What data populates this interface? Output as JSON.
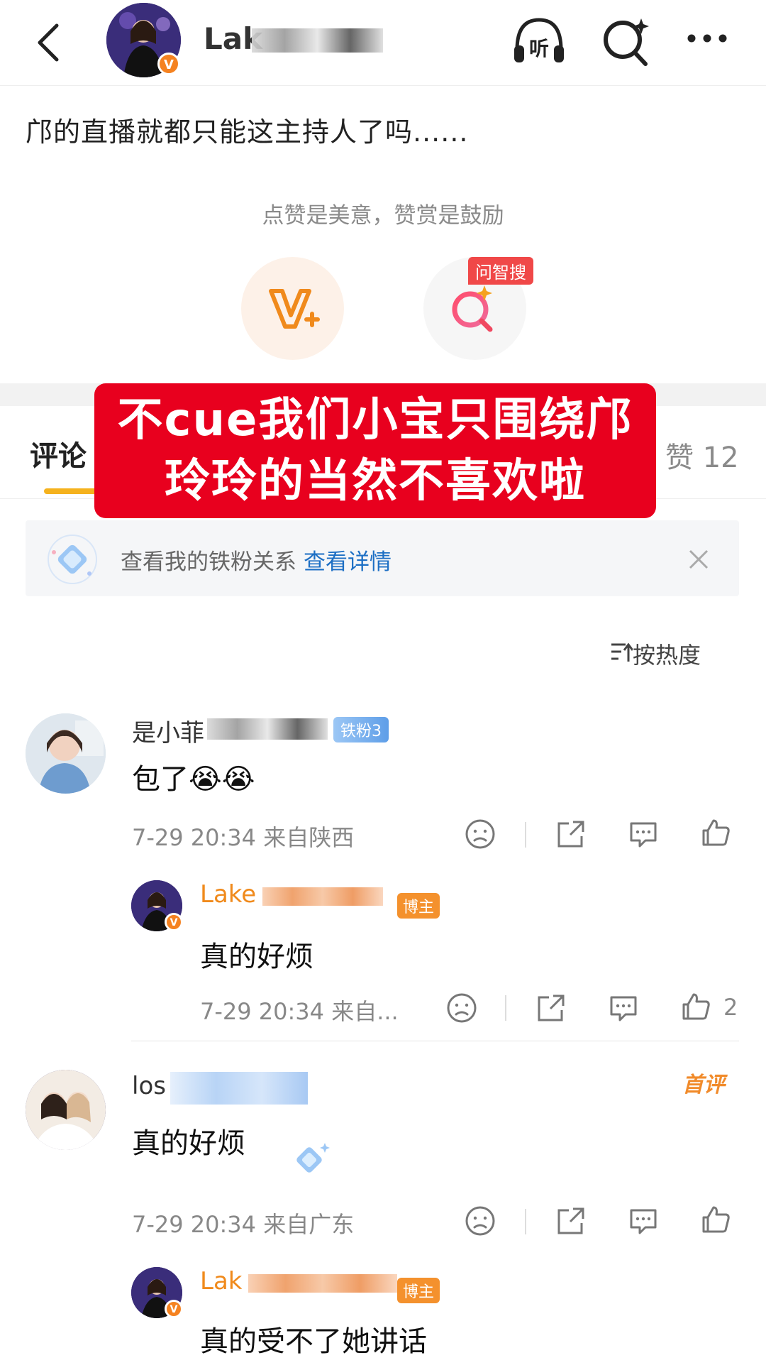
{
  "topbar": {
    "name_visible": "Lak",
    "badge": "V",
    "listen_label": "听"
  },
  "post": {
    "text": "邝的直播就都只能这主持人了吗......"
  },
  "reward": {
    "tip": "点赞是美意，赞赏是鼓励",
    "ask_tag": "问智搜"
  },
  "overlay": {
    "line1": "不cue我们小宝只围绕邝",
    "line2": "玲玲的当然不喜欢啦"
  },
  "tabs": {
    "comment": "评论",
    "like": "赞 12"
  },
  "fan_bar": {
    "text": "查看我的铁粉关系",
    "link": "查看详情"
  },
  "sort": {
    "label": "按热度"
  },
  "comments": [
    {
      "name_visible": "是小菲",
      "badge": "铁粉3",
      "text": "包了😭😭",
      "meta": "7-29 20:34  来自陕西",
      "reply": {
        "name_visible": "Lake",
        "badge": "博主",
        "text": "真的好烦",
        "meta": "7-29 20:34  来自...",
        "like_count": "2"
      }
    },
    {
      "name_visible": "los",
      "first_tag": "首评",
      "text": "真的好烦",
      "meta": "7-29 20:34  来自广东",
      "reply": {
        "name_visible": "Lak",
        "badge": "博主",
        "text": "真的受不了她讲话"
      }
    }
  ],
  "colors": {
    "accent_orange": "#f58220",
    "overlay_red": "#e8001e",
    "link_blue": "#1d6fc4",
    "tab_underline": "#f5b21e"
  }
}
